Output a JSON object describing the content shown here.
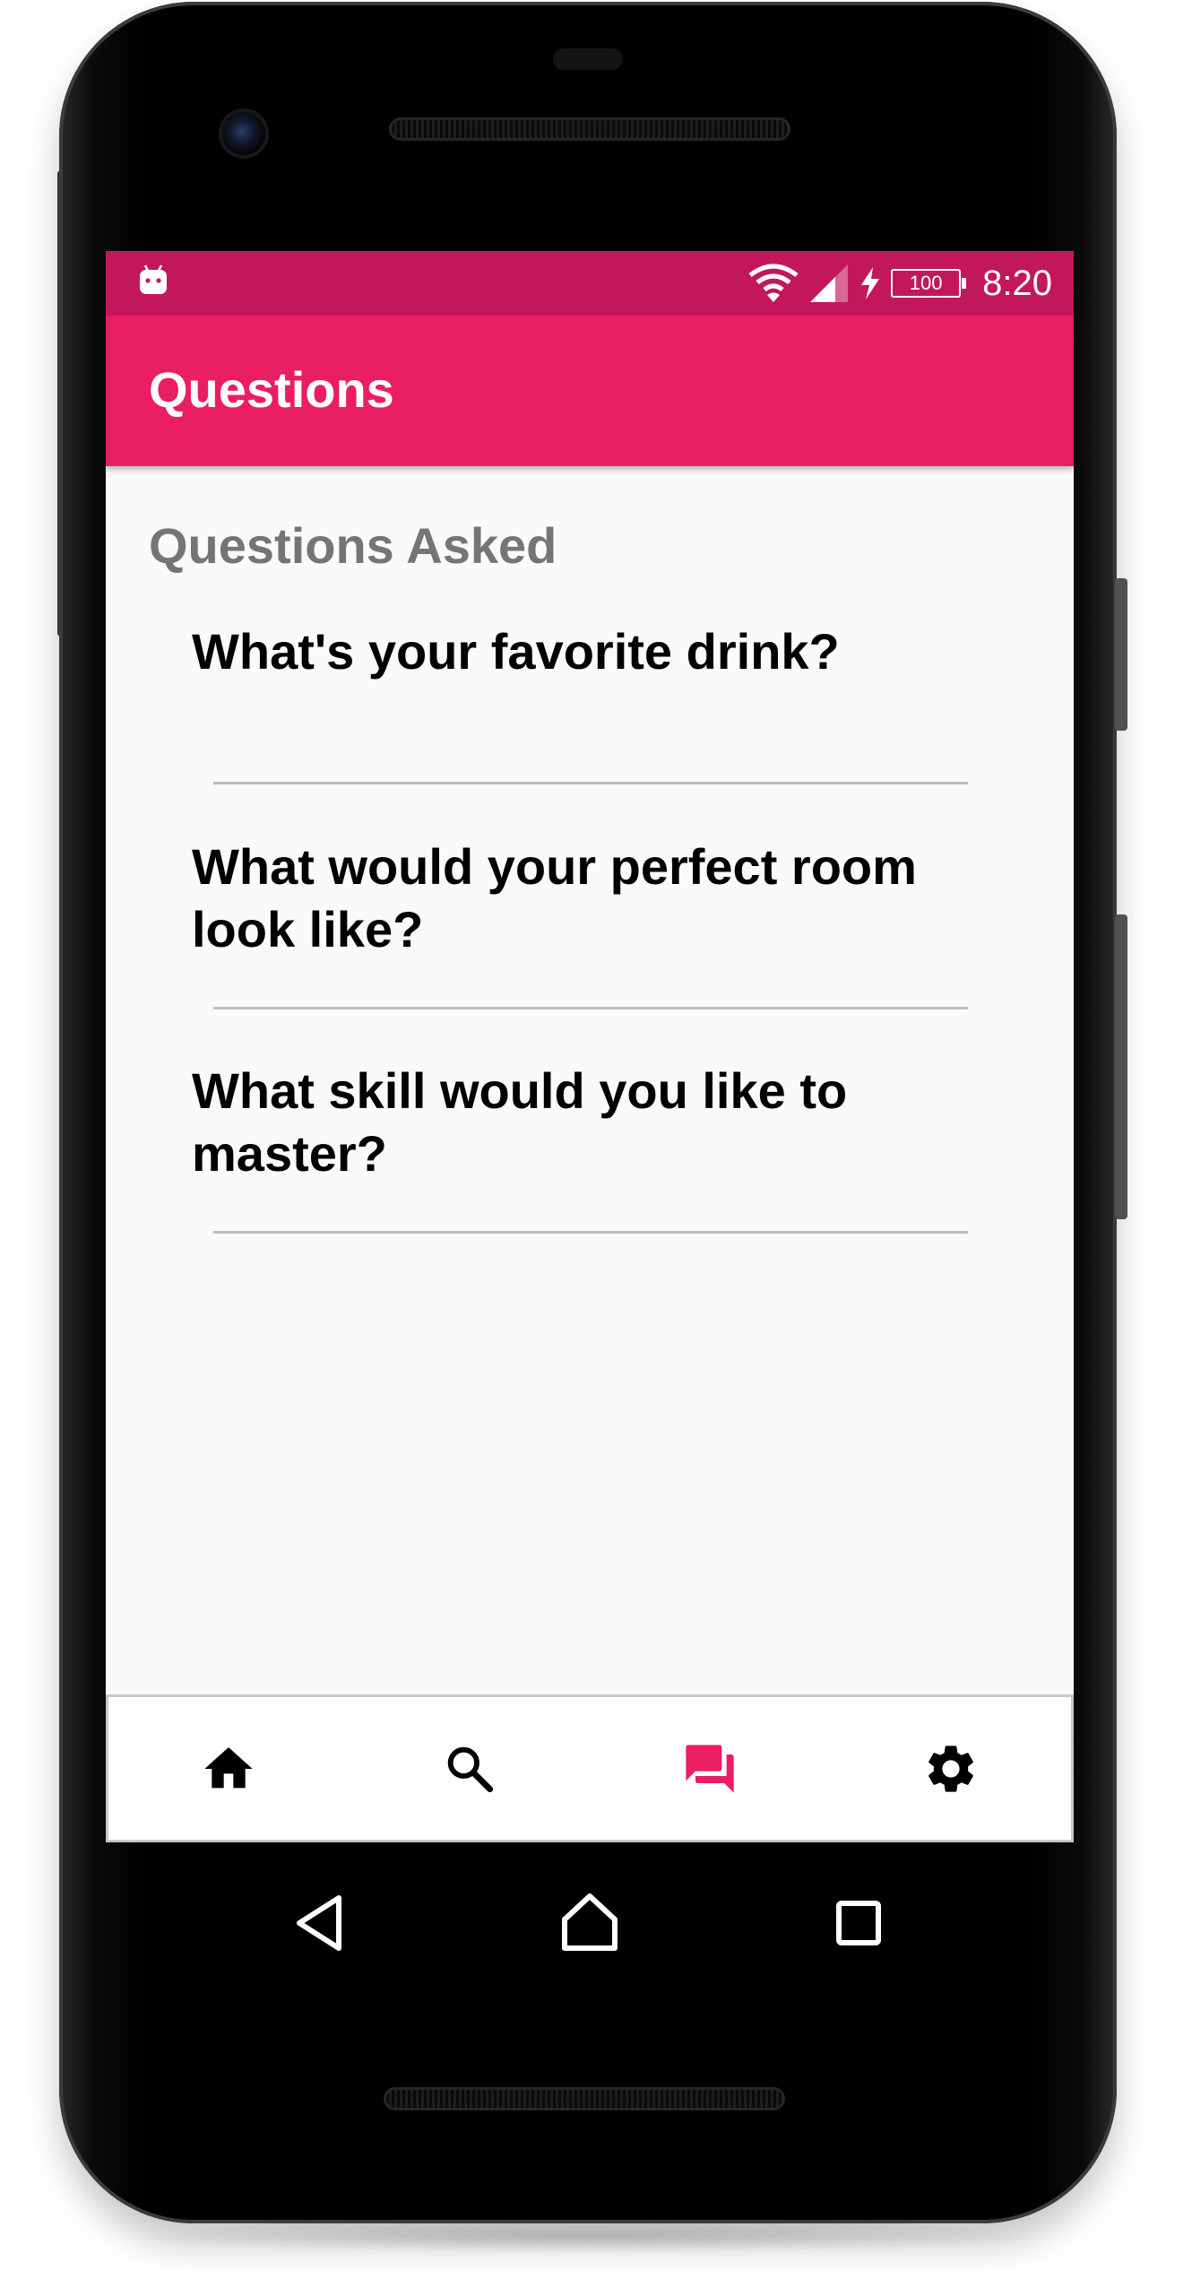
{
  "status_bar": {
    "battery": "100",
    "time": "8:20"
  },
  "app_bar": {
    "title": "Questions"
  },
  "main": {
    "section_title": "Questions Asked",
    "questions": [
      "What's your favorite drink?",
      "What would your perfect room look like?",
      "What skill would you like to master?"
    ]
  },
  "bottom_nav": {
    "items": [
      {
        "icon": "home-icon",
        "active": false
      },
      {
        "icon": "search-icon",
        "active": false
      },
      {
        "icon": "forum-icon",
        "active": true
      },
      {
        "icon": "settings-icon",
        "active": false
      }
    ]
  },
  "colors": {
    "primary": "#e91e63",
    "primary_dark": "#c2185b",
    "inactive_icon": "#000000",
    "section_title": "#757575"
  }
}
